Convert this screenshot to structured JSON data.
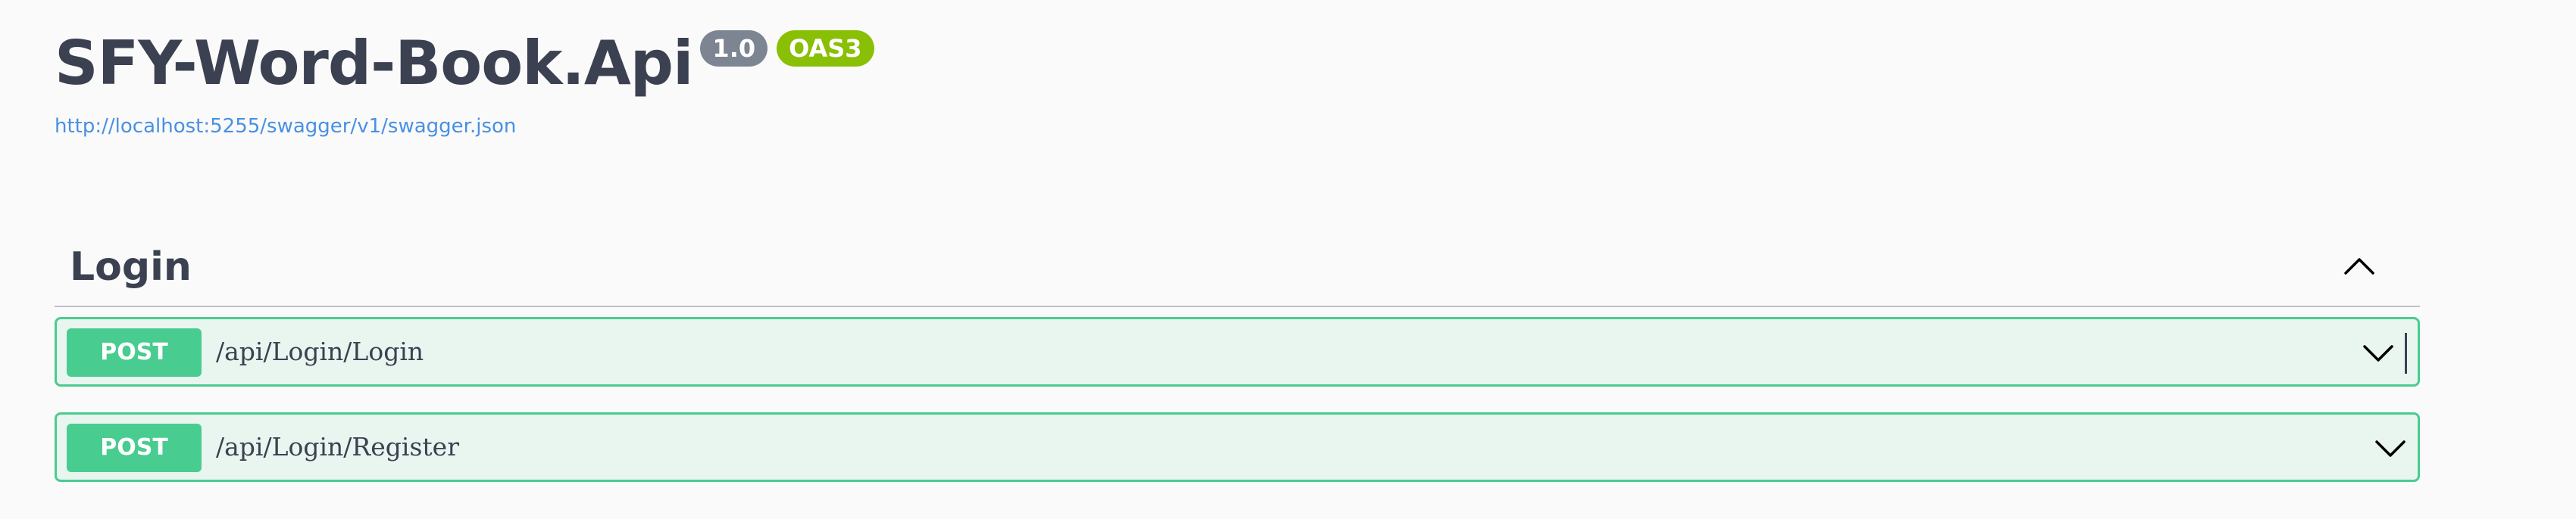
{
  "info": {
    "title": "SFY-Word-Book.Api",
    "version": "1.0",
    "oas_badge": "OAS3",
    "spec_url": "http://localhost:5255/swagger/v1/swagger.json"
  },
  "tags": [
    {
      "name": "Login",
      "expanded": true,
      "operations": [
        {
          "method": "POST",
          "path": "/api/Login/Login"
        },
        {
          "method": "POST",
          "path": "/api/Login/Register"
        }
      ]
    }
  ],
  "icons": {
    "tag_toggle": "chevron-up-icon",
    "operation_toggle": "chevron-down-icon"
  },
  "colors": {
    "post_accent": "#49cc90",
    "post_background": "#e9f5ef",
    "version_badge": "#7d8492",
    "oas_badge": "#89bf04",
    "link": "#4990e2",
    "text": "#3b4151"
  }
}
